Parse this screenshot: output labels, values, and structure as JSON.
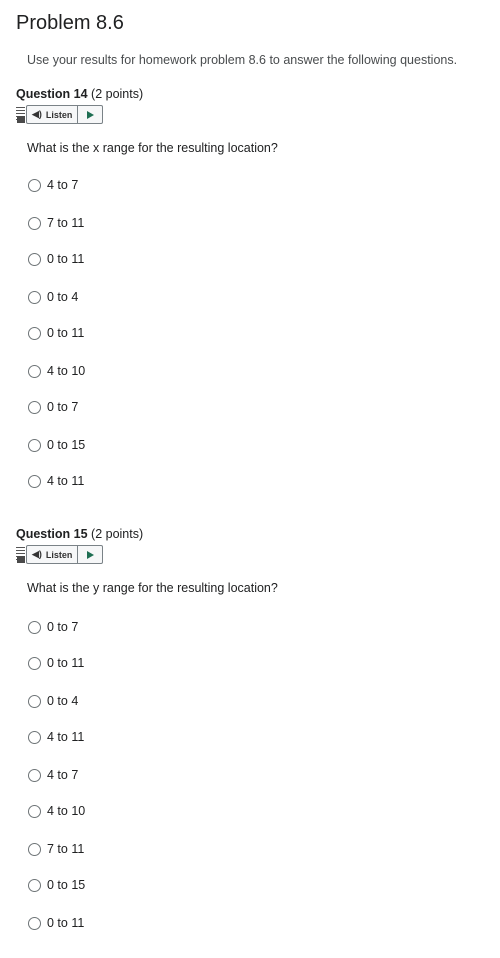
{
  "page": {
    "title": "Problem 8.6",
    "intro": "Use your results for homework problem 8.6 to answer the following questions."
  },
  "listen": {
    "label": "Listen"
  },
  "questions": [
    {
      "title": "Question 14",
      "points": "(2 points)",
      "text": "What is the x range for the resulting location?",
      "options": [
        "4 to 7",
        "7 to 11",
        "0 to 11",
        "0 to 4",
        "0 to 11",
        "4 to 10",
        "0 to 7",
        "0 to 15",
        "4 to 11"
      ]
    },
    {
      "title": "Question 15",
      "points": "(2 points)",
      "text": "What is the y range for the resulting location?",
      "options": [
        "0 to 7",
        "0 to 11",
        "0 to 4",
        "4 to 11",
        "4 to 7",
        "4 to 10",
        "7 to 11",
        "0 to 15",
        "0 to 11"
      ]
    }
  ]
}
